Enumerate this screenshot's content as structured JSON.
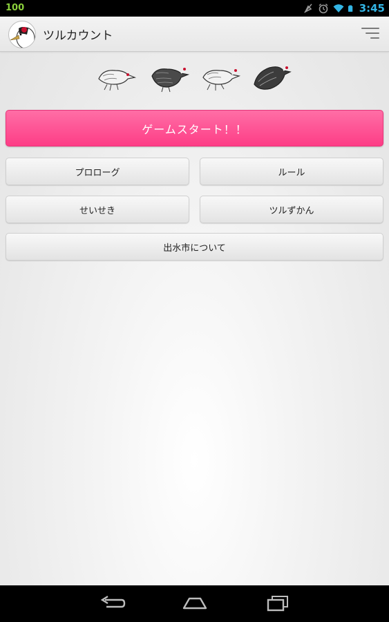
{
  "status_bar": {
    "battery_text": "100",
    "time": "3:45",
    "icons": [
      "notification-muted-icon",
      "alarm-icon",
      "wifi-icon",
      "battery-icon"
    ]
  },
  "action_bar": {
    "title": "ツルカウント",
    "menu_icon": "overflow-menu-icon"
  },
  "illustrations": [
    "crane-white-icon",
    "crane-dark-icon",
    "crane-white-icon",
    "crane-dark-icon"
  ],
  "buttons": {
    "start": "ゲームスタート！！",
    "prologue": "プロローグ",
    "rules": "ルール",
    "records": "せいせき",
    "encyclopedia": "ツルずかん",
    "about_city": "出水市について"
  },
  "colors": {
    "start_button": "#fd4a8d",
    "clock": "#33b5e5",
    "battery_text": "#8cd13c"
  },
  "nav_bar": {
    "icons": [
      "back-icon",
      "home-icon",
      "recent-apps-icon"
    ]
  }
}
